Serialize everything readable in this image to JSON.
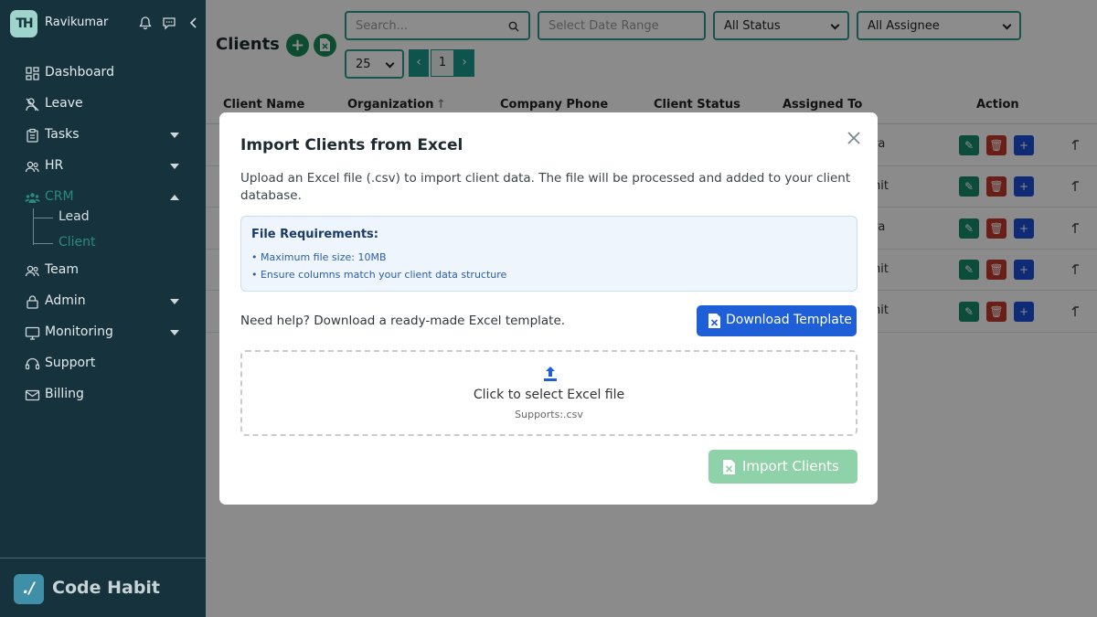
{
  "sidebar": {
    "username": "Ravikumar",
    "avatar_initials": "TH",
    "menu": [
      {
        "label": "Dashboard",
        "icon": "dashboard-icon"
      },
      {
        "label": "Leave",
        "icon": "leave-icon"
      },
      {
        "label": "Tasks",
        "icon": "tasks-icon",
        "expandable": true
      },
      {
        "label": "HR",
        "icon": "hr-icon",
        "expandable": true
      },
      {
        "label": "CRM",
        "icon": "crm-icon",
        "expandable": true,
        "expanded": true,
        "active": true
      },
      {
        "label": "Team",
        "icon": "team-icon"
      },
      {
        "label": "Admin",
        "icon": "admin-icon",
        "expandable": true
      },
      {
        "label": "Monitoring",
        "icon": "monitoring-icon",
        "expandable": true
      },
      {
        "label": "Support",
        "icon": "support-icon"
      },
      {
        "label": "Billing",
        "icon": "billing-icon"
      }
    ],
    "crm_sub": [
      {
        "label": "Lead"
      },
      {
        "label": "Client",
        "active": true
      }
    ],
    "brand_mark": "./",
    "brand": "Code Habit"
  },
  "main": {
    "title": "Clients",
    "search_placeholder": "Search...",
    "date_placeholder": "Select Date Range",
    "status_filter": "All Status",
    "assignee_filter": "All Assignee",
    "page_size": "25",
    "current_page": "1",
    "columns": [
      "Client Name",
      "Organization",
      "Company Phone",
      "Client Status",
      "Assigned To",
      "Action"
    ],
    "assigned_partial": [
      "ra",
      "hit",
      "ra",
      "hit",
      "hit"
    ]
  },
  "modal": {
    "title": "Import Clients from Excel",
    "description": "Upload an Excel file (.csv) to import client data. The file will be processed and added to your client database.",
    "requirements_title": "File Requirements:",
    "requirements": [
      "• Maximum file size: 10MB",
      "• Ensure columns match your client data structure"
    ],
    "help_text": "Need help? Download a ready-made Excel template.",
    "download_button": "Download Template",
    "drop_text": "Click to select Excel file",
    "drop_subtext": "Supports:.csv",
    "import_button": "Import Clients"
  },
  "colors": {
    "sidebar_bg": "#16323c",
    "accent_teal": "#1a9a8a",
    "primary_blue": "#1e5fd8",
    "import_disabled": "#8fd1a8"
  }
}
